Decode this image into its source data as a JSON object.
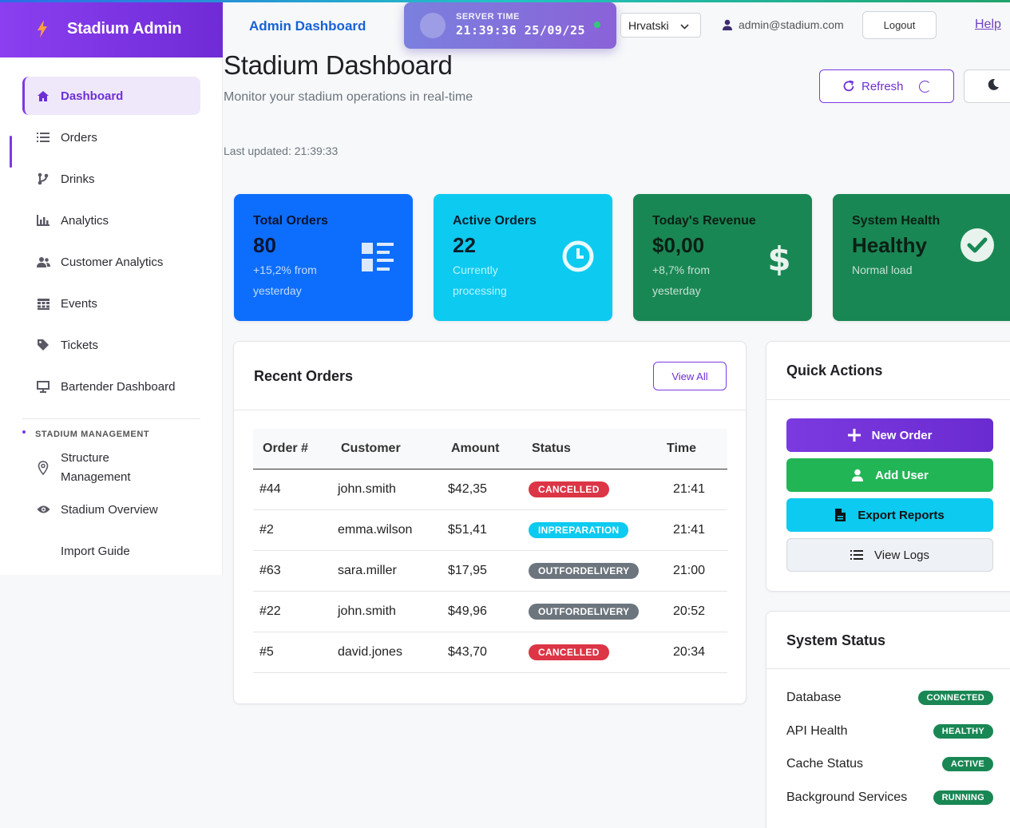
{
  "brand": {
    "name": "Stadium Admin"
  },
  "sidebar": {
    "items": [
      {
        "label": "Dashboard",
        "icon": "home-icon",
        "active": true
      },
      {
        "label": "Orders",
        "icon": "list-icon"
      },
      {
        "label": "Drinks",
        "icon": "branch-icon"
      },
      {
        "label": "Analytics",
        "icon": "bar-chart-icon"
      },
      {
        "label": "Customer Analytics",
        "icon": "users-icon"
      },
      {
        "label": "Events",
        "icon": "calendar-icon"
      },
      {
        "label": "Tickets",
        "icon": "tag-icon"
      },
      {
        "label": "Bartender Dashboard",
        "icon": "monitor-icon"
      }
    ],
    "section_title": "STADIUM MANAGEMENT",
    "management_items": [
      {
        "label": "Structure Management",
        "icon": "map-pin-icon"
      },
      {
        "label": "Stadium Overview",
        "icon": "eye-icon"
      },
      {
        "label": "Import Guide",
        "icon": ""
      }
    ]
  },
  "header": {
    "title": "Admin Dashboard",
    "server_time_label": "SERVER TIME",
    "server_time": "21:39:36 25/09/25",
    "language": "Hrvatski",
    "user_email": "admin@stadium.com",
    "logout": "Logout",
    "help": "Help"
  },
  "page": {
    "title": "Stadium Dashboard",
    "subtitle": "Monitor your stadium operations in real-time",
    "last_updated": "Last updated: 21:39:33",
    "refresh": "Refresh"
  },
  "stats": [
    {
      "title": "Total Orders",
      "value": "80",
      "sub": "+15,2% from yesterday",
      "icon": "list-alt-icon",
      "color": "#0d6efd"
    },
    {
      "title": "Active Orders",
      "value": "22",
      "sub": "Currently processing",
      "icon": "clock-icon",
      "color": "#0dcaf0"
    },
    {
      "title": "Today's Revenue",
      "value": "$0,00",
      "sub": "+8,7% from yesterday",
      "icon": "dollar-icon",
      "color": "#198754"
    },
    {
      "title": "System Health",
      "value": "Healthy",
      "sub": "Normal load",
      "icon": "check-circle-icon",
      "color": "#198754"
    }
  ],
  "recent_orders": {
    "title": "Recent Orders",
    "view_all": "View All",
    "columns": [
      "Order #",
      "Customer",
      "Amount",
      "Status",
      "Time"
    ],
    "rows": [
      {
        "order": "#44",
        "customer": "john.smith",
        "amount": "$42,35",
        "status": "CANCELLED",
        "status_color": "#dc3545",
        "time": "21:41"
      },
      {
        "order": "#2",
        "customer": "emma.wilson",
        "amount": "$51,41",
        "status": "INPREPARATION",
        "status_color": "#0dcaf0",
        "time": "21:41"
      },
      {
        "order": "#63",
        "customer": "sara.miller",
        "amount": "$17,95",
        "status": "OUTFORDELIVERY",
        "status_color": "#6c757d",
        "time": "21:00"
      },
      {
        "order": "#22",
        "customer": "john.smith",
        "amount": "$49,96",
        "status": "OUTFORDELIVERY",
        "status_color": "#6c757d",
        "time": "20:52"
      },
      {
        "order": "#5",
        "customer": "david.jones",
        "amount": "$43,70",
        "status": "CANCELLED",
        "status_color": "#dc3545",
        "time": "20:34"
      }
    ]
  },
  "quick_actions": {
    "title": "Quick Actions",
    "buttons": [
      {
        "label": "New Order",
        "icon": "plus-icon",
        "color": "#7b3ae0"
      },
      {
        "label": "Add User",
        "icon": "user-icon",
        "color": "#22b556"
      },
      {
        "label": "Export Reports",
        "icon": "file-export-icon",
        "color": "#0dcaf0"
      },
      {
        "label": "View Logs",
        "icon": "list-icon",
        "color": "#eef1f5"
      }
    ]
  },
  "system_status": {
    "title": "System Status",
    "rows": [
      {
        "label": "Database",
        "status": "CONNECTED"
      },
      {
        "label": "API Health",
        "status": "HEALTHY"
      },
      {
        "label": "Cache Status",
        "status": "ACTIVE"
      },
      {
        "label": "Background Services",
        "status": "RUNNING"
      }
    ]
  }
}
